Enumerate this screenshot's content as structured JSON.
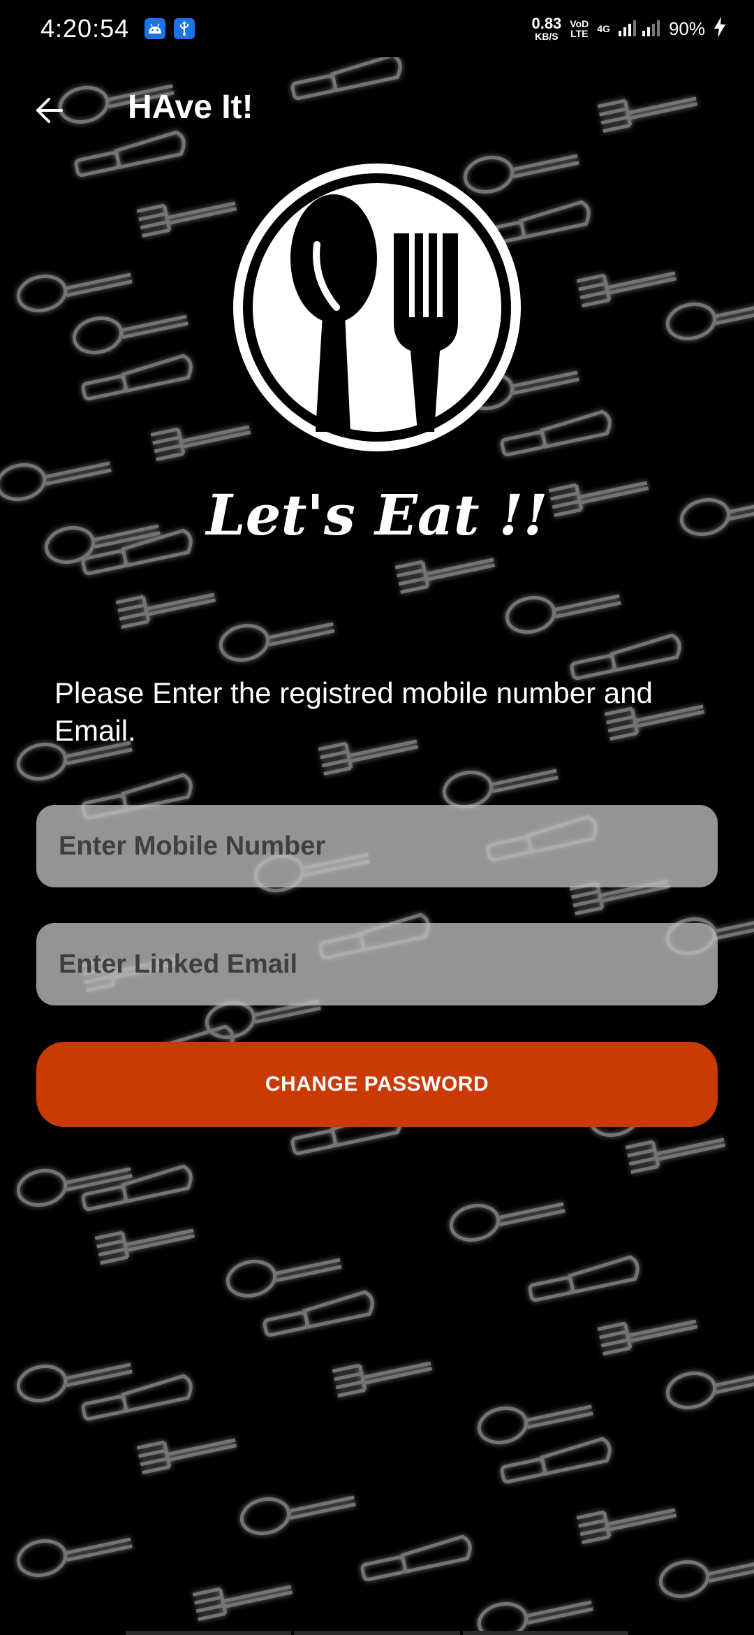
{
  "status_bar": {
    "time": "4:20:54",
    "net_speed_value": "0.83",
    "net_speed_unit": "KB/S",
    "volte_top": "VoD",
    "volte_bottom": "LTE",
    "network_type": "4G",
    "battery": "90%"
  },
  "header": {
    "title": "HAve It!"
  },
  "tagline": "Let's Eat !!",
  "instruction": "Please Enter the registred mobile number and Email.",
  "form": {
    "mobile_placeholder": "Enter Mobile Number",
    "email_placeholder": "Enter Linked Email",
    "submit_label": "CHANGE PASSWORD"
  },
  "colors": {
    "background": "#000000",
    "accent": "#c93a05",
    "input_bg": "#bebebe"
  },
  "icons": {
    "back": "arrow-left-icon",
    "logo": "spoon-fork-plate-icon",
    "android": "android-icon",
    "usb": "usb-icon",
    "signal": "signal-icon",
    "charging": "charging-bolt-icon"
  }
}
